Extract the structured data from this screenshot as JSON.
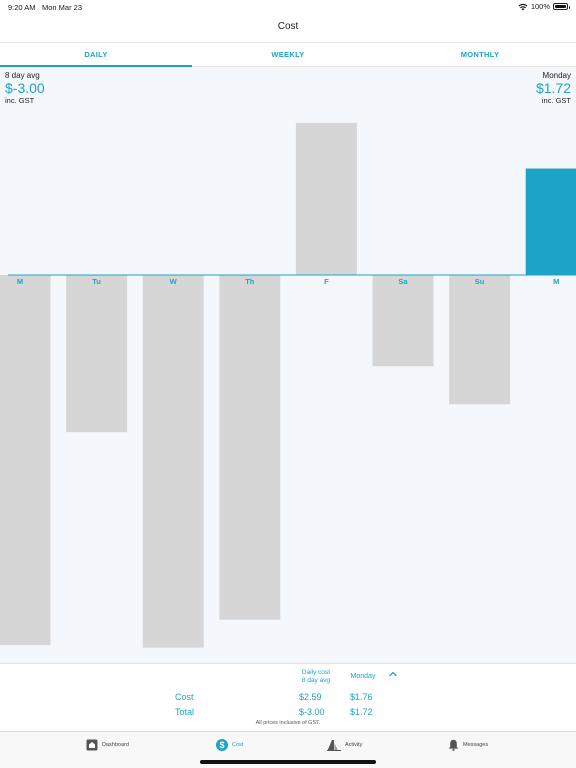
{
  "status_bar": {
    "time": "9:20 AM",
    "date": "Mon Mar 23",
    "battery": "100%",
    "wifi_icon": "wifi-icon",
    "battery_icon": "battery-icon",
    "battery_level": 1.0
  },
  "nav": {
    "title": "Cost"
  },
  "tabs": [
    {
      "label": "DAILY",
      "active": true
    },
    {
      "label": "WEEKLY",
      "active": false
    },
    {
      "label": "MONTHLY",
      "active": false
    }
  ],
  "summary": {
    "left": {
      "label": "8 day avg",
      "value": "$-3.00",
      "sub": "inc. GST"
    },
    "right": {
      "label": "Monday",
      "value": "$1.72",
      "sub": "inc. GST"
    }
  },
  "chart_data": {
    "type": "bar",
    "categories": [
      "M",
      "Tu",
      "W",
      "Th",
      "F",
      "Sa",
      "Su",
      "M"
    ],
    "values": [
      -14.6,
      -6.2,
      -14.7,
      -13.6,
      6.0,
      -3.6,
      -5.1,
      4.2
    ],
    "highlight_index": 7,
    "colors": {
      "bar": "#d7d6d6",
      "highlight": "#1ba4c8",
      "zero_line": "#1ba4c8",
      "tick_label": "#1ba4c8"
    },
    "title": "",
    "xlabel": "",
    "ylabel": ""
  },
  "bottom_panel": {
    "col1_header_line1": "Daily cost",
    "col1_header_line2": "8 day avg",
    "col2_header": "Monday",
    "chevron_icon": "chevron-up-icon",
    "rows": [
      {
        "label": "Cost",
        "avg": "$2.59",
        "day": "$1.76"
      },
      {
        "label": "Total",
        "avg": "$-3.00",
        "day": "$1.72"
      }
    ],
    "note": "All prices inclusive of GST."
  },
  "tab_bar": [
    {
      "label": "Dashboard",
      "icon": "home-icon",
      "active": false
    },
    {
      "label": "Cost",
      "icon": "dollar-icon",
      "active": true
    },
    {
      "label": "Activity",
      "icon": "activity-icon",
      "active": false
    },
    {
      "label": "Messages",
      "icon": "bell-icon",
      "active": false
    }
  ]
}
